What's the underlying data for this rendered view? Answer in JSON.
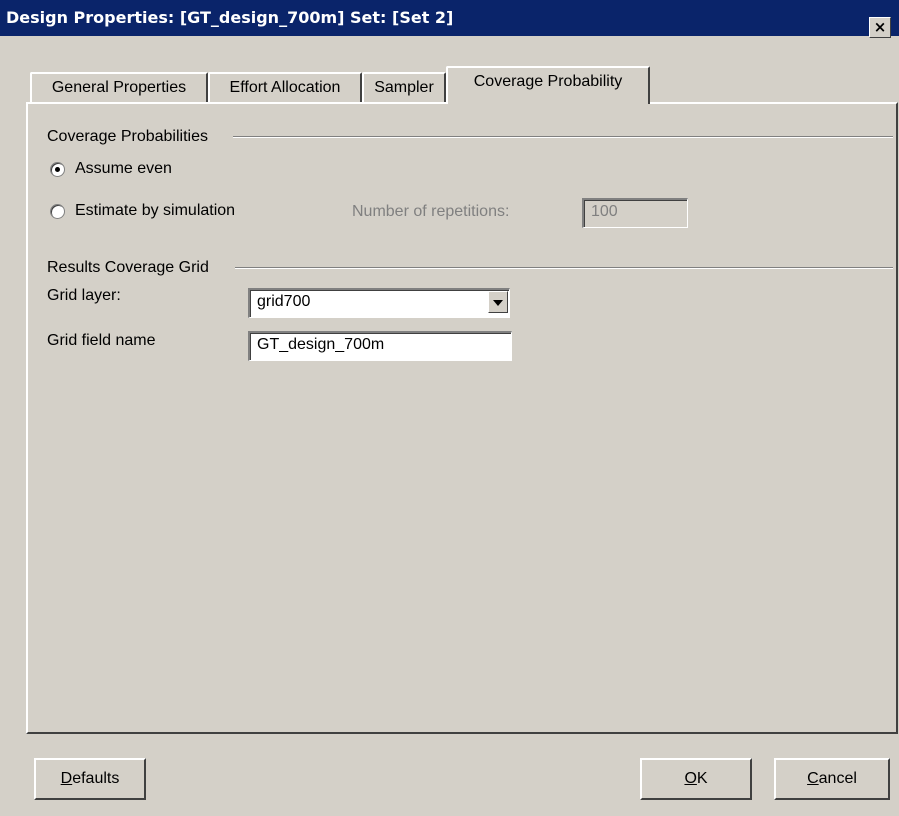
{
  "window": {
    "title": "Design Properties: [GT_design_700m] Set: [Set 2]",
    "close_label": "×"
  },
  "tabs": [
    {
      "label": "General Properties",
      "active": false
    },
    {
      "label": "Effort Allocation",
      "active": false
    },
    {
      "label": "Sampler",
      "active": false
    },
    {
      "label": "Coverage Probability",
      "active": true
    }
  ],
  "coverage": {
    "group_label": "Coverage Probabilities",
    "assume_even_label": "Assume even",
    "assume_even_selected": true,
    "estimate_label": "Estimate by simulation",
    "estimate_selected": false,
    "repetitions_label": "Number of  repetitions:",
    "repetitions_value": "100"
  },
  "grid": {
    "group_label": "Results Coverage Grid",
    "layer_label": "Grid layer:",
    "layer_value": "grid700",
    "field_label": "Grid field name",
    "field_value": "GT_design_700m"
  },
  "buttons": {
    "defaults_first": "D",
    "defaults_rest": "efaults",
    "ok_first": "O",
    "ok_rest": "K",
    "cancel_first": "C",
    "cancel_rest": "ancel"
  }
}
